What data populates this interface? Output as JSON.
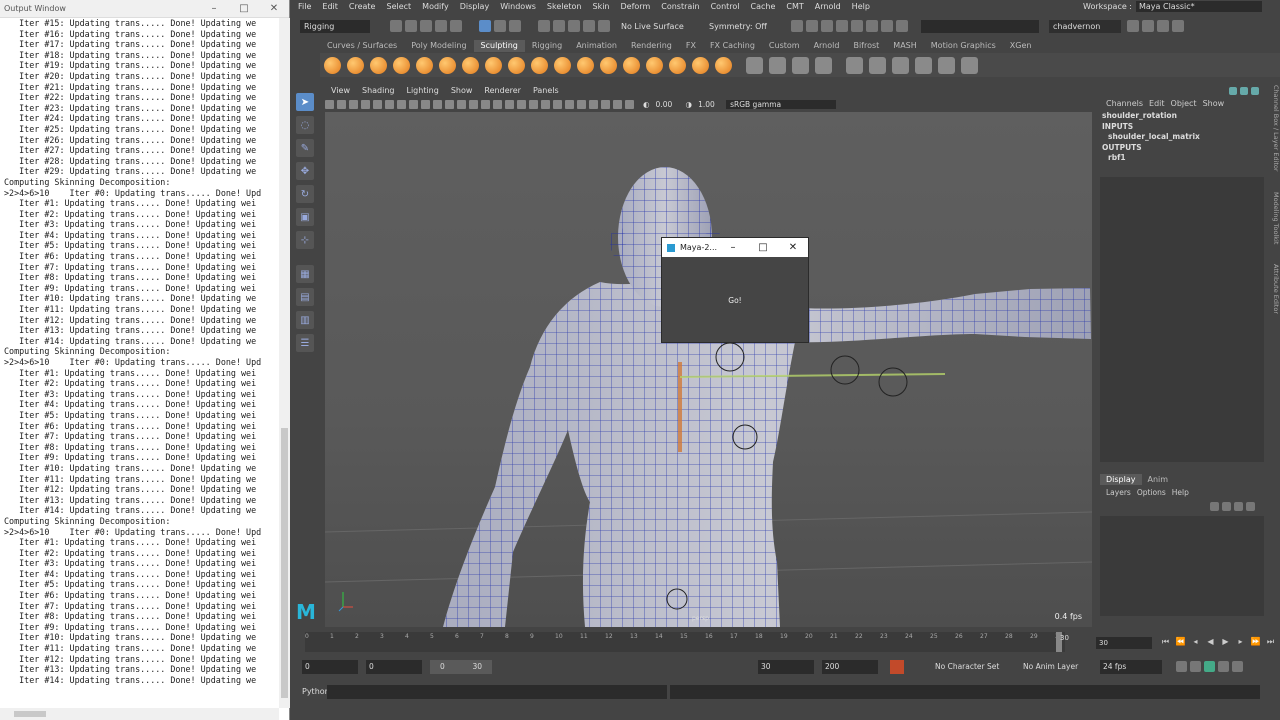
{
  "output_window": {
    "title": "Output Window",
    "controls": [
      "–",
      "□",
      "✕"
    ],
    "lines": [
      "   Iter #15: Updating trans..... Done! Updating we",
      "   Iter #16: Updating trans..... Done! Updating we",
      "   Iter #17: Updating trans..... Done! Updating we",
      "   Iter #18: Updating trans..... Done! Updating we",
      "   Iter #19: Updating trans..... Done! Updating we",
      "   Iter #20: Updating trans..... Done! Updating we",
      "   Iter #21: Updating trans..... Done! Updating we",
      "   Iter #22: Updating trans..... Done! Updating we",
      "   Iter #23: Updating trans..... Done! Updating we",
      "   Iter #24: Updating trans..... Done! Updating we",
      "   Iter #25: Updating trans..... Done! Updating we",
      "   Iter #26: Updating trans..... Done! Updating we",
      "   Iter #27: Updating trans..... Done! Updating we",
      "   Iter #28: Updating trans..... Done! Updating we",
      "   Iter #29: Updating trans..... Done! Updating we",
      "Computing Skinning Decomposition:",
      ">2>4>6>10    Iter #0: Updating trans..... Done! Upd",
      "   Iter #1: Updating trans..... Done! Updating wei",
      "   Iter #2: Updating trans..... Done! Updating wei",
      "   Iter #3: Updating trans..... Done! Updating wei",
      "   Iter #4: Updating trans..... Done! Updating wei",
      "   Iter #5: Updating trans..... Done! Updating wei",
      "   Iter #6: Updating trans..... Done! Updating wei",
      "   Iter #7: Updating trans..... Done! Updating wei",
      "   Iter #8: Updating trans..... Done! Updating wei",
      "   Iter #9: Updating trans..... Done! Updating wei",
      "   Iter #10: Updating trans..... Done! Updating we",
      "   Iter #11: Updating trans..... Done! Updating we",
      "   Iter #12: Updating trans..... Done! Updating we",
      "   Iter #13: Updating trans..... Done! Updating we",
      "   Iter #14: Updating trans..... Done! Updating we",
      "Computing Skinning Decomposition:",
      ">2>4>6>10    Iter #0: Updating trans..... Done! Upd",
      "   Iter #1: Updating trans..... Done! Updating wei",
      "   Iter #2: Updating trans..... Done! Updating wei",
      "   Iter #3: Updating trans..... Done! Updating wei",
      "   Iter #4: Updating trans..... Done! Updating wei",
      "   Iter #5: Updating trans..... Done! Updating wei",
      "   Iter #6: Updating trans..... Done! Updating wei",
      "   Iter #7: Updating trans..... Done! Updating wei",
      "   Iter #8: Updating trans..... Done! Updating wei",
      "   Iter #9: Updating trans..... Done! Updating wei",
      "   Iter #10: Updating trans..... Done! Updating we",
      "   Iter #11: Updating trans..... Done! Updating we",
      "   Iter #12: Updating trans..... Done! Updating we",
      "   Iter #13: Updating trans..... Done! Updating we",
      "   Iter #14: Updating trans..... Done! Updating we",
      "Computing Skinning Decomposition:",
      ">2>4>6>10    Iter #0: Updating trans..... Done! Upd",
      "   Iter #1: Updating trans..... Done! Updating wei",
      "   Iter #2: Updating trans..... Done! Updating wei",
      "   Iter #3: Updating trans..... Done! Updating wei",
      "   Iter #4: Updating trans..... Done! Updating wei",
      "   Iter #5: Updating trans..... Done! Updating wei",
      "   Iter #6: Updating trans..... Done! Updating wei",
      "   Iter #7: Updating trans..... Done! Updating wei",
      "   Iter #8: Updating trans..... Done! Updating wei",
      "   Iter #9: Updating trans..... Done! Updating wei",
      "   Iter #10: Updating trans..... Done! Updating we",
      "   Iter #11: Updating trans..... Done! Updating we",
      "   Iter #12: Updating trans..... Done! Updating we",
      "   Iter #13: Updating trans..... Done! Updating we",
      "   Iter #14: Updating trans..... Done! Updating we"
    ]
  },
  "menu": [
    "File",
    "Edit",
    "Create",
    "Select",
    "Modify",
    "Display",
    "Windows",
    "Skeleton",
    "Skin",
    "Deform",
    "Constrain",
    "Control",
    "Cache",
    "CMT",
    "Arnold",
    "Help"
  ],
  "workspace": {
    "label": "Workspace :",
    "value": "Maya Classic*"
  },
  "status": {
    "menuset": "Rigging",
    "live_surface": "No Live Surface",
    "symmetry": "Symmetry: Off",
    "user": "chadvernon"
  },
  "shelf_tabs": [
    "Curves / Surfaces",
    "Poly Modeling",
    "Sculpting",
    "Rigging",
    "Animation",
    "Rendering",
    "FX",
    "FX Caching",
    "Custom",
    "Arnold",
    "Bifrost",
    "MASH",
    "Motion Graphics",
    "XGen"
  ],
  "shelf_active": "Sculpting",
  "panel_menu": [
    "View",
    "Shading",
    "Lighting",
    "Show",
    "Renderer",
    "Panels"
  ],
  "panel_bar": {
    "exposure": "0.00",
    "gamma": "1.00",
    "color_space": "sRGB gamma"
  },
  "viewport": {
    "fps": "0.4 fps",
    "camera": "persp"
  },
  "dialog": {
    "title": "Maya-2...",
    "button": "Go!",
    "controls": [
      "–",
      "□",
      "✕"
    ]
  },
  "channel_box": {
    "menu": [
      "Channels",
      "Edit",
      "Object",
      "Show"
    ],
    "node": "shoulder_rotation",
    "inputs_label": "INPUTS",
    "input": "shoulder_local_matrix",
    "outputs_label": "OUTPUTS",
    "output": "rbf1"
  },
  "side_tabs": [
    "Channel Box / Layer Editor",
    "Modeling Toolkit",
    "Attribute Editor"
  ],
  "layer_editor": {
    "tabs": [
      "Display",
      "Anim"
    ],
    "active": "Display",
    "menu": [
      "Layers",
      "Options",
      "Help"
    ]
  },
  "timeline": {
    "ticks": [
      "0",
      "1",
      "2",
      "3",
      "4",
      "5",
      "6",
      "7",
      "8",
      "9",
      "10",
      "11",
      "12",
      "13",
      "14",
      "15",
      "16",
      "17",
      "18",
      "19",
      "20",
      "21",
      "22",
      "23",
      "24",
      "25",
      "26",
      "27",
      "28",
      "29",
      "30"
    ],
    "end_frame": "30",
    "current_frame": "30"
  },
  "range": {
    "start": "0",
    "anim_start": "0",
    "slider_min": "0",
    "slider_max": "30",
    "end": "30",
    "anim_end": "200",
    "character_set": "No Character Set",
    "anim_layer": "No Anim Layer",
    "fps": "24 fps"
  },
  "command_line": {
    "label": "Python"
  },
  "colors": {
    "wire": "#1a2aa8",
    "accent": "#5b8dc9",
    "shelf_orange": "#e27a1c"
  }
}
